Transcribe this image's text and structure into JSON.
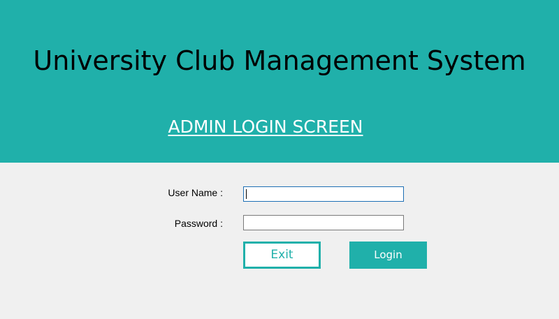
{
  "header": {
    "app_title": "University Club Management System",
    "screen_title": "ADMIN LOGIN SCREEN"
  },
  "form": {
    "username_label": "User Name :",
    "username_value": "",
    "password_label": "Password :",
    "password_value": ""
  },
  "buttons": {
    "exit_label": "Exit",
    "login_label": "Login"
  },
  "colors": {
    "accent": "#20b0aa",
    "background": "#f0f0f0",
    "focus_border": "#1e6fb5"
  }
}
